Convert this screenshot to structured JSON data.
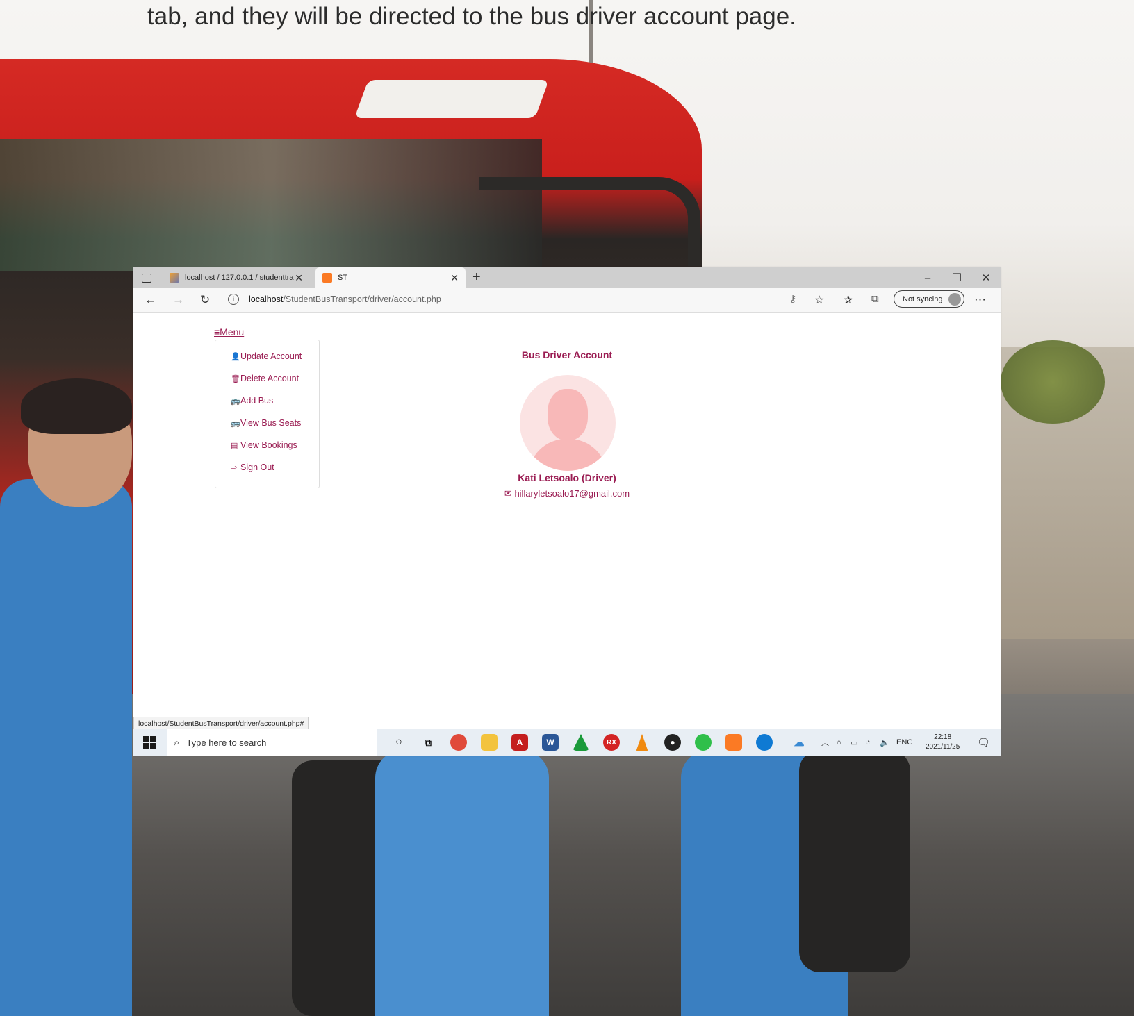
{
  "caption": "tab, and they will be directed to the bus driver account page.",
  "browser": {
    "tabs": [
      {
        "label": "localhost / 127.0.0.1 / studenttra",
        "icon": "phpmyadmin-icon"
      },
      {
        "label": "ST",
        "icon": "xampp-icon"
      }
    ],
    "address_host": "localhost",
    "address_path": "/StudentBusTransport/driver/account.php",
    "sync_label": "Not syncing",
    "status_url": "localhost/StudentBusTransport/driver/account.php#"
  },
  "page": {
    "menu_label": "Menu",
    "menu_items": [
      {
        "label": "Update Account",
        "icon": "user-icon"
      },
      {
        "label": "Delete Account",
        "icon": "trash-icon"
      },
      {
        "label": "Add Bus",
        "icon": "bus-icon"
      },
      {
        "label": "View Bus Seats",
        "icon": "bus-icon"
      },
      {
        "label": "View Bookings",
        "icon": "table-icon"
      },
      {
        "label": "Sign Out",
        "icon": "sign-out-icon"
      }
    ],
    "title": "Bus Driver Account",
    "driver_name": "Kati Letsoalo (Driver)",
    "driver_email": "hillaryletsoalo17@gmail.com",
    "accent": "#9a1c52"
  },
  "taskbar": {
    "search_placeholder": "Type here to search",
    "language": "ENG",
    "time": "22:18",
    "date": "2021/11/25"
  }
}
